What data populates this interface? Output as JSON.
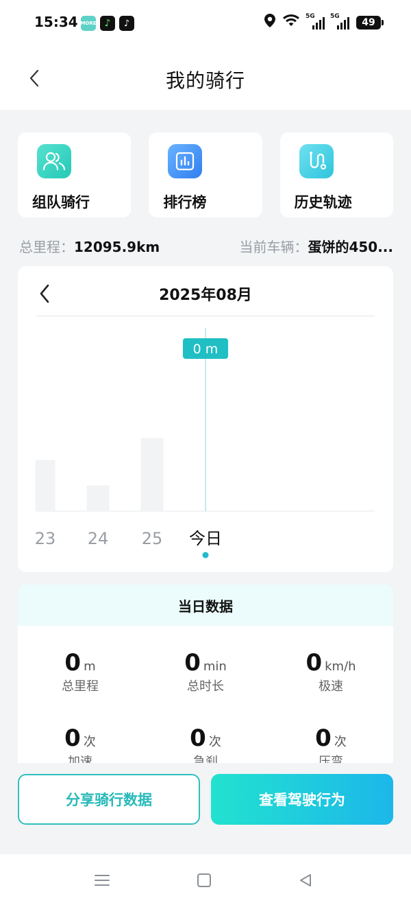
{
  "status_bar": {
    "time": "15:34",
    "apps": [
      "MOREFUN",
      "music-app-icon",
      "tiktok-icon"
    ],
    "signal_label_1": "5G",
    "signal_label_2": "5G",
    "battery": "49"
  },
  "header": {
    "title": "我的骑行"
  },
  "features": [
    {
      "label": "组队骑行",
      "icon": "team-riding-icon"
    },
    {
      "label": "排行榜",
      "icon": "leaderboard-icon"
    },
    {
      "label": "历史轨迹",
      "icon": "history-track-icon"
    }
  ],
  "totals": {
    "distance_label": "总里程：",
    "distance_value": "12095.9km",
    "vehicle_label": "当前车辆：",
    "vehicle_value": "蛋饼的450..."
  },
  "chart": {
    "month_title": "2025年08月",
    "tooltip": "0 m",
    "selected_index": 3
  },
  "chart_data": {
    "type": "bar",
    "categories": [
      "23",
      "24",
      "25",
      "今日"
    ],
    "values": [
      0.28,
      0.14,
      0.4,
      0
    ],
    "ylim": [
      0,
      1
    ]
  },
  "day_data": {
    "title": "当日数据",
    "metrics": [
      {
        "value": "0",
        "unit": "m",
        "label": "总里程"
      },
      {
        "value": "0",
        "unit": "min",
        "label": "总时长"
      },
      {
        "value": "0",
        "unit": "km/h",
        "label": "极速"
      },
      {
        "value": "0",
        "unit": "次",
        "label": "加速"
      },
      {
        "value": "0",
        "unit": "次",
        "label": "急刹"
      },
      {
        "value": "0",
        "unit": "次",
        "label": "压弯"
      }
    ]
  },
  "buttons": {
    "share": "分享骑行数据",
    "view_behavior": "查看驾驶行为"
  },
  "colors": {
    "accent": "#2fbfc0",
    "bar": "#f1f3f5",
    "today_dot": "#22b8cf",
    "tooltip_bg": "#1fbfc4"
  }
}
